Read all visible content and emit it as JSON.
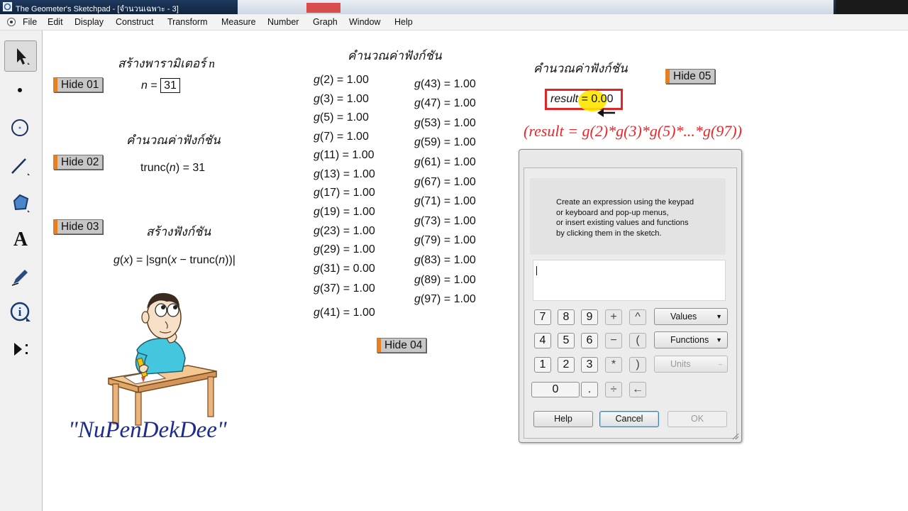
{
  "window": {
    "title": "The Geometer's Sketchpad - [จำนวนเฉพาะ - 3]"
  },
  "menu": [
    "File",
    "Edit",
    "Display",
    "Construct",
    "Transform",
    "Measure",
    "Number",
    "Graph",
    "Window",
    "Help"
  ],
  "toolbox": {
    "tools": [
      "arrow-select-icon",
      "point-tool-icon",
      "compass-tool-icon",
      "straightedge-tool-icon",
      "polygon-tool-icon",
      "text-tool-icon",
      "marker-tool-icon",
      "information-tool-icon",
      "custom-tool-icon"
    ],
    "text_tool_glyph": "A"
  },
  "sketch": {
    "hide_buttons": [
      "Hide 01",
      "Hide 02",
      "Hide 03",
      "Hide 04",
      "Hide 05"
    ],
    "headings": {
      "param": "สร้างพารามิเตอร์ n",
      "calc_left": "คำนวณค่าฟังก์ชัน",
      "func": "สร้างฟังก์ชัน",
      "calc_mid": "คำนวณค่าฟังก์ชัน",
      "calc_right": "คำนวณค่าฟังก์ชัน"
    },
    "param": {
      "name": "n",
      "eq": " = ",
      "value": "31"
    },
    "trunc": {
      "pre": "trunc(",
      "var": "n",
      "post": ") = 31"
    },
    "func": {
      "name": "g",
      "open": "(",
      "var": "x",
      "body": ") = |sgn(",
      "var2": "x",
      "minus": " − trunc(",
      "var3": "n",
      "close": "))|"
    },
    "g_values_left": [
      {
        "arg": "2",
        "value": "1.00"
      },
      {
        "arg": "3",
        "value": "1.00"
      },
      {
        "arg": "5",
        "value": "1.00"
      },
      {
        "arg": "7",
        "value": "1.00"
      },
      {
        "arg": "11",
        "value": "1.00"
      },
      {
        "arg": "13",
        "value": "1.00"
      },
      {
        "arg": "17",
        "value": "1.00"
      },
      {
        "arg": "19",
        "value": "1.00"
      },
      {
        "arg": "23",
        "value": "1.00"
      },
      {
        "arg": "29",
        "value": "1.00"
      },
      {
        "arg": "31",
        "value": "0.00"
      },
      {
        "arg": "37",
        "value": "1.00"
      },
      {
        "arg": "41",
        "value": "1.00"
      }
    ],
    "g_values_right": [
      {
        "arg": "43",
        "value": "1.00"
      },
      {
        "arg": "47",
        "value": "1.00"
      },
      {
        "arg": "53",
        "value": "1.00"
      },
      {
        "arg": "59",
        "value": "1.00"
      },
      {
        "arg": "61",
        "value": "1.00"
      },
      {
        "arg": "67",
        "value": "1.00"
      },
      {
        "arg": "71",
        "value": "1.00"
      },
      {
        "arg": "73",
        "value": "1.00"
      },
      {
        "arg": "79",
        "value": "1.00"
      },
      {
        "arg": "83",
        "value": "1.00"
      },
      {
        "arg": "89",
        "value": "1.00"
      },
      {
        "arg": "97",
        "value": "1.00"
      }
    ],
    "result": {
      "name": "result",
      "value": " = 0.00"
    },
    "formula": "(result = g(2)*g(3)*g(5)*...*g(97))",
    "signature": "\"NuPenDekDee\""
  },
  "calculator": {
    "instructions": "Create an expression using the keypad\nor keyboard and pop-up menus,\nor insert existing values and functions\nby clicking them in the sketch.",
    "expression_value": "",
    "keypad": {
      "row1": [
        "7",
        "8",
        "9",
        "+",
        "^"
      ],
      "row2": [
        "4",
        "5",
        "6",
        "−",
        "("
      ],
      "row3": [
        "1",
        "2",
        "3",
        "*",
        ")"
      ],
      "row4": [
        "0",
        ".",
        "÷",
        "←"
      ]
    },
    "menus": {
      "values": "Values",
      "functions": "Functions",
      "units": "Units"
    },
    "buttons": {
      "help": "Help",
      "cancel": "Cancel",
      "ok": "OK"
    }
  },
  "colors": {
    "hide_accent": "#e67e22",
    "result_border": "#e02525",
    "result_highlight": "#ffe600",
    "formula": "#e8262b",
    "signature": "#1d2a8e"
  }
}
